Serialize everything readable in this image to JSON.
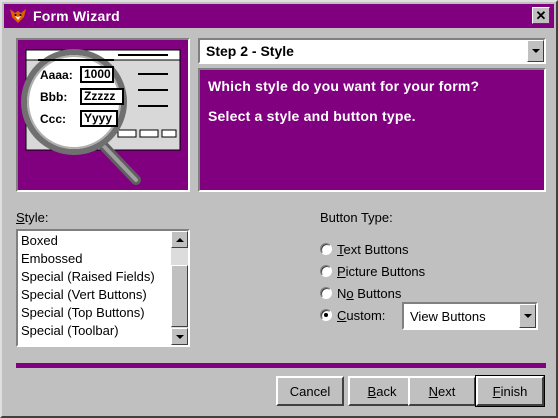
{
  "window": {
    "title": "Form Wizard",
    "title_icon": "fox-icon",
    "close_label": "✕"
  },
  "colors": {
    "accent": "#800080",
    "face": "#c0c0c0"
  },
  "illustration": {
    "fields": [
      {
        "label": "Aaaa:",
        "value": "1000"
      },
      {
        "label": "Bbb:",
        "value": "Zzzzz"
      },
      {
        "label": "Ccc:",
        "value": "Yyyy"
      }
    ]
  },
  "step": {
    "selected": "Step 2 - Style"
  },
  "instructions": {
    "question": "Which style do you want for your form?",
    "hint": "Select a style and button type."
  },
  "style": {
    "label_prefix": "",
    "label_mnemonic": "S",
    "label_rest": "tyle:",
    "items": [
      "Boxed",
      "Embossed",
      "Special (Raised Fields)",
      "Special (Vert Buttons)",
      "Special (Top Buttons)",
      "Special (Toolbar)"
    ]
  },
  "button_type": {
    "label": "Button Type:",
    "options": [
      {
        "mnemonic": "T",
        "rest": "ext Buttons",
        "checked": false
      },
      {
        "mnemonic": "P",
        "rest": "icture Buttons",
        "checked": false
      },
      {
        "prefix": "N",
        "mnemonic": "o",
        "rest": " Buttons",
        "checked": false
      },
      {
        "mnemonic": "C",
        "rest": "ustom:",
        "checked": true
      }
    ],
    "custom_value": "View Buttons"
  },
  "buttons": {
    "cancel": "Cancel",
    "back_mnemonic": "B",
    "back_rest": "ack",
    "next_mnemonic": "N",
    "next_rest": "ext",
    "finish_mnemonic": "F",
    "finish_rest": "inish"
  }
}
